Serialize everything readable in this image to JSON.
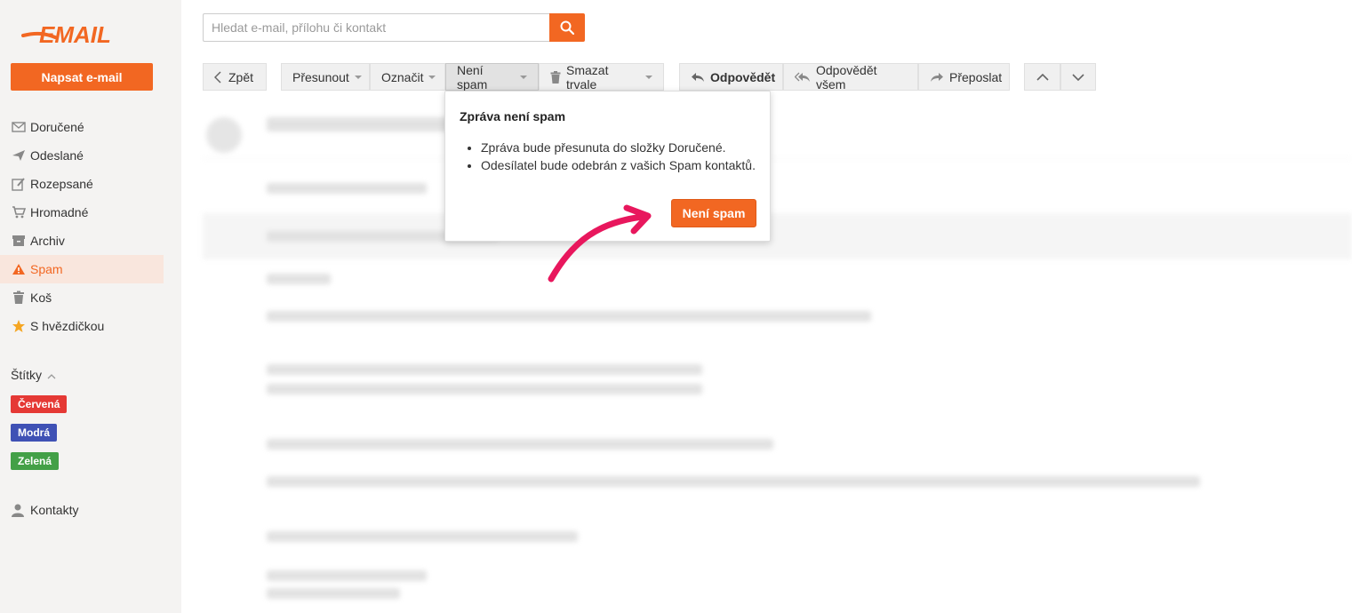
{
  "brand": {
    "logo_text": "EMAIL",
    "accent": "#f26722"
  },
  "compose": {
    "label": "Napsat e-mail"
  },
  "sidebar": {
    "items": [
      {
        "label": "Doručené",
        "icon": "inbox-icon"
      },
      {
        "label": "Odeslané",
        "icon": "send-icon"
      },
      {
        "label": "Rozepsané",
        "icon": "draft-icon"
      },
      {
        "label": "Hromadné",
        "icon": "cart-icon"
      },
      {
        "label": "Archiv",
        "icon": "archive-icon"
      },
      {
        "label": "Spam",
        "icon": "warning-icon",
        "active": true
      },
      {
        "label": "Koš",
        "icon": "trash-icon"
      },
      {
        "label": "S hvězdičkou",
        "icon": "star-icon"
      }
    ],
    "labels_heading": "Štítky",
    "tags": [
      {
        "label": "Červená",
        "color": "#e53935"
      },
      {
        "label": "Modrá",
        "color": "#3f51b5"
      },
      {
        "label": "Zelená",
        "color": "#43a047"
      }
    ],
    "contacts": "Kontakty"
  },
  "search": {
    "placeholder": "Hledat e-mail, přílohu či kontakt",
    "value": ""
  },
  "toolbar": {
    "back": "Zpět",
    "move": "Přesunout",
    "mark": "Označit",
    "not_spam": "Není spam",
    "delete": "Smazat trvale",
    "reply": "Odpovědět",
    "reply_all": "Odpovědět všem",
    "forward": "Přeposlat"
  },
  "popover": {
    "title": "Zpráva není spam",
    "bullets": [
      "Zpráva bude přesunuta do složky Doručené.",
      "Odesílatel bude odebrán z vašich Spam kontaktů."
    ],
    "button": "Není spam"
  }
}
